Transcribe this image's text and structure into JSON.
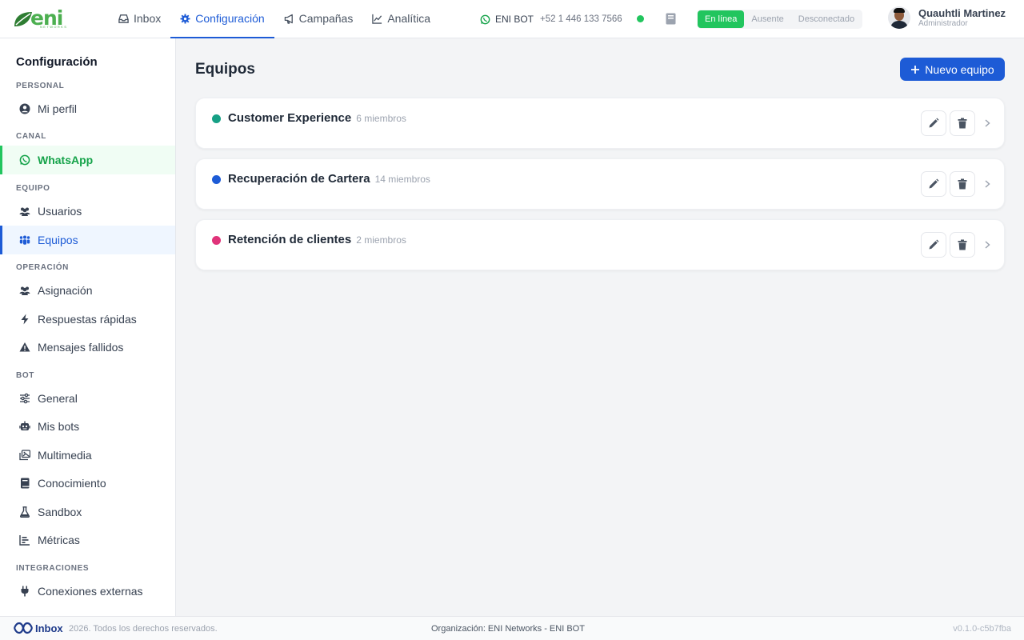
{
  "header": {
    "logo_text": "eni",
    "logo_sub": "NETWORKS",
    "nav": [
      {
        "label": "Inbox",
        "icon": "inbox-icon"
      },
      {
        "label": "Configuración",
        "icon": "gear-icon",
        "active": true
      },
      {
        "label": "Campañas",
        "icon": "megaphone-icon"
      },
      {
        "label": "Analítica",
        "icon": "chart-line-icon"
      }
    ],
    "bot_name": "ENI BOT",
    "bot_phone": "+52 1 446 133 7566",
    "status_options": [
      "En línea",
      "Ausente",
      "Desconectado"
    ],
    "status_selected": "En línea",
    "user_name": "Quauhtli Martinez",
    "user_role": "Administrador"
  },
  "sidebar": {
    "title": "Configuración",
    "sections": {
      "personal": "PERSONAL",
      "canal": "CANAL",
      "equipo": "EQUIPO",
      "operacion": "OPERACIÓN",
      "bot": "BOT",
      "integraciones": "INTEGRACIONES"
    },
    "items": {
      "perfil": "Mi perfil",
      "whatsapp": "WhatsApp",
      "usuarios": "Usuarios",
      "equipos": "Equipos",
      "asignacion": "Asignación",
      "respuestas": "Respuestas rápidas",
      "fallidos": "Mensajes fallidos",
      "general": "General",
      "bots": "Mis bots",
      "multimedia": "Multimedia",
      "conocimiento": "Conocimiento",
      "sandbox": "Sandbox",
      "metricas": "Métricas",
      "conexiones": "Conexiones externas"
    }
  },
  "main": {
    "title": "Equipos",
    "new_button": "Nuevo equipo",
    "teams": [
      {
        "name": "Customer Experience",
        "members": "6 miembros",
        "color": "#16a085"
      },
      {
        "name": "Recuperación de Cartera",
        "members": "14 miembros",
        "color": "#1d5bd6"
      },
      {
        "name": "Retención de clientes",
        "members": "2 miembros",
        "color": "#e0337a"
      }
    ]
  },
  "footer": {
    "brand": "Inbox",
    "copyright": "2026. Todos los derechos reservados.",
    "organization": "Organización: ENI Networks - ENI BOT",
    "version": "v0.1.0-c5b7fba"
  },
  "colors": {
    "primary": "#1d5bd6",
    "online": "#22c55e",
    "whatsapp": "#16a34a"
  }
}
